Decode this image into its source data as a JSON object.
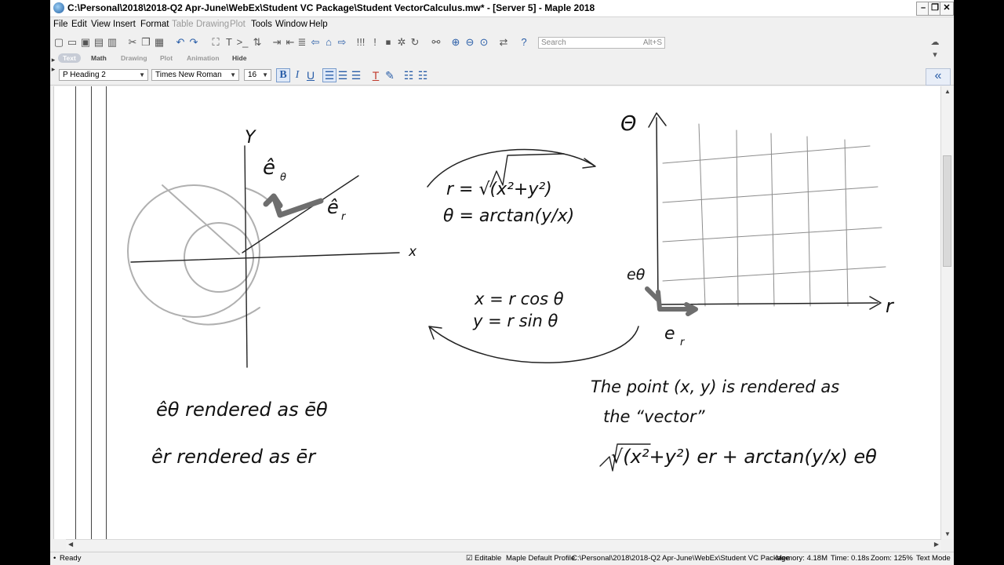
{
  "window": {
    "title": "C:\\Personal\\2018\\2018-Q2 Apr-June\\WebEx\\Student VC Package\\Student VectorCalculus.mw* - [Server 5] - Maple 2018",
    "minimize_glyph": "–",
    "restore_glyph": "❐",
    "close_glyph": "✕"
  },
  "menu": {
    "items": [
      "File",
      "Edit",
      "View",
      "Insert",
      "Format",
      "Table",
      "Drawing",
      "Plot",
      "Tools",
      "Window",
      "Help"
    ]
  },
  "toolbar": {
    "search_placeholder": "Search",
    "search_hint": "Alt+S"
  },
  "modes": [
    "Text",
    "Math",
    "Drawing",
    "Plot",
    "Animation",
    "Hide"
  ],
  "format": {
    "style": "P  Heading 2",
    "font": "Times New Roman",
    "size": "16"
  },
  "collapse_glyph": "«",
  "drawing": {
    "left_y": "Y",
    "left_x": "x",
    "e_theta_hat": "ê",
    "theta_sub": "θ",
    "e_r_hat": "ê",
    "r_sub": "r",
    "forward_r": "r = √(x²+y²)",
    "forward_theta": "θ = arctan(y/x)",
    "inverse_x": "x = r cos θ",
    "inverse_y": "y = r sin θ",
    "right_theta": "Θ",
    "right_r": "r",
    "grid_e_theta": "eθ",
    "grid_e_r": "e",
    "grid_r_sub": "r",
    "line1": "êθ  rendered as  ēθ",
    "line2": "êr  rendered as  ēr",
    "point_line1": "The point (x, y) is rendered as",
    "point_line2": "the “vector”",
    "point_line3": "√(x²+y²) er + arctan(y/x) eθ"
  },
  "status": {
    "ready": "Ready",
    "editable": "Editable",
    "profile": "Maple Default Profile",
    "path": "C:\\Personal\\2018\\2018-Q2 Apr-June\\WebEx\\Student VC Package",
    "memory": "Memory: 4.18M",
    "time": "Time: 0.18s",
    "zoom": "Zoom: 125%",
    "mode": "Text Mode"
  }
}
